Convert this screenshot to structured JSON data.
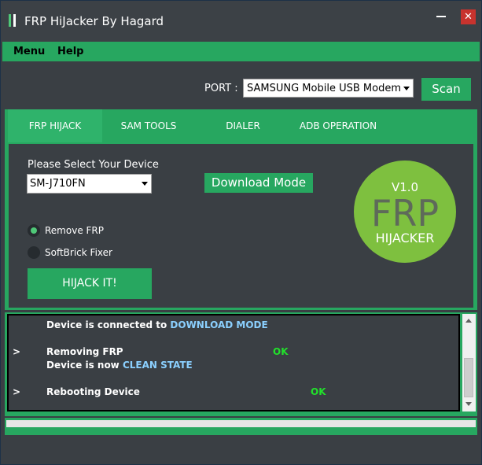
{
  "window": {
    "title": "FRP HiJacker By Hagard",
    "close_glyph": "✕"
  },
  "menu": {
    "items": [
      "Menu",
      "Help"
    ]
  },
  "port": {
    "label": "PORT :",
    "selected": "SAMSUNG Mobile USB Modem (C",
    "scan_label": "Scan"
  },
  "tabs": [
    "FRP HIJACK",
    "SAM TOOLS",
    "DIALER",
    "ADB OPERATION"
  ],
  "active_tab": "FRP HIJACK",
  "frp_panel": {
    "device_label": "Please Select Your Device",
    "device_selected": "SM-J710FN",
    "download_mode_label": "Download Mode",
    "radio_remove_frp": "Remove FRP",
    "radio_softbrick": "SoftBrick Fixer",
    "selected_option": "Remove FRP",
    "hijack_label": "HIJACK IT!"
  },
  "logo": {
    "version": "V1.0",
    "main": "FRP",
    "sub": "HIJACKER"
  },
  "log": {
    "line1_text": "Device is connected to ",
    "line1_hl": "DOWNLOAD MODE",
    "line2_prefix": ">",
    "line2_text": "Removing FRP",
    "line2_status": "OK",
    "line3_text": "Device is now ",
    "line3_hl": "CLEAN STATE",
    "line4_prefix": ">",
    "line4_text": "Rebooting Device",
    "line4_status": "OK"
  },
  "progress": {
    "value": 0
  },
  "colors": {
    "accent": "#27a760",
    "background": "#3a3f44",
    "ok": "#21e12b",
    "highlight": "#8bd0ff",
    "close": "#c8332e",
    "logo": "#7ec03f"
  }
}
